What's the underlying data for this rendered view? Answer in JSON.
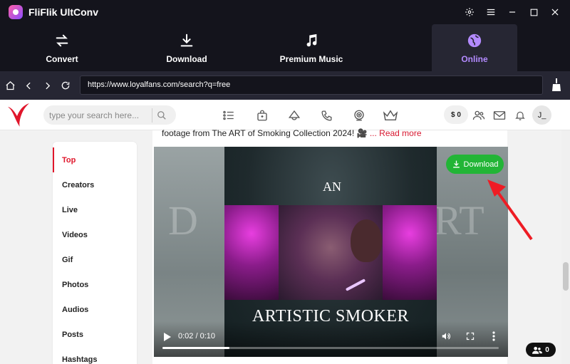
{
  "window": {
    "title": "FliFlik UltConv"
  },
  "tabs": [
    {
      "label": "Convert",
      "icon": "convert-icon"
    },
    {
      "label": "Download",
      "icon": "download-icon"
    },
    {
      "label": "Premium Music",
      "icon": "music-note-icon"
    },
    {
      "label": "Online",
      "icon": "globe-icon",
      "active": true
    }
  ],
  "navbar": {
    "url": "https://www.loyalfans.com/search?q=free"
  },
  "site": {
    "search_placeholder": "type your search here...",
    "balance": "$ 0",
    "avatar": "J_"
  },
  "sidebar": {
    "items": [
      "Top",
      "Creators",
      "Live",
      "Videos",
      "Gif",
      "Photos",
      "Audios",
      "Posts",
      "Hashtags"
    ],
    "active": "Top"
  },
  "post": {
    "text": "footage from The ART of Smoking Collection 2024!",
    "emoji": "🎥",
    "read_more": "... Read more"
  },
  "video": {
    "overlay_top": "AN",
    "overlay_title": "ARTISTIC SMOKER",
    "bg_text_left": "D",
    "bg_text_right": "RT",
    "time": "0:02 / 0:10",
    "progress": 0.2
  },
  "download_button": {
    "label": "Download"
  },
  "users_badge": {
    "count": "0"
  },
  "colors": {
    "accent_purple": "#b38aff",
    "download_green": "#22b536",
    "brand_red": "#e0162b",
    "arrow_red": "#ee1c24"
  }
}
